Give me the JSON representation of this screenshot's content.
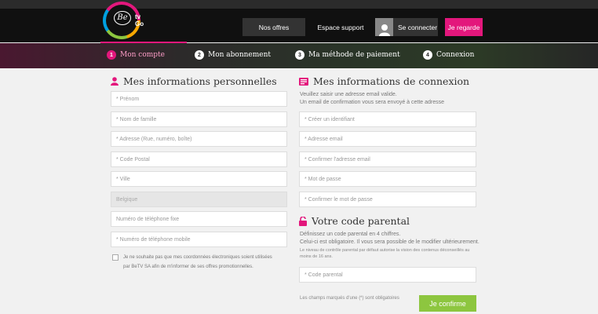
{
  "header": {
    "logo_text": "Be",
    "logo_sub1": "tv",
    "logo_sub2": "Go",
    "nav": {
      "offres": "Nos offres",
      "support": "Espace support",
      "connect": "Se connecter",
      "regarde": "Je regarde"
    }
  },
  "steps": [
    {
      "num": "1",
      "label": "Mon compte"
    },
    {
      "num": "2",
      "label": "Mon abonnement"
    },
    {
      "num": "3",
      "label": "Ma méthode de paiement"
    },
    {
      "num": "4",
      "label": "Connexion"
    }
  ],
  "personal": {
    "title": "Mes informations personnelles",
    "fields": [
      "* Prénom",
      "* Nom de famille",
      "* Adresse (Rue, numéro, boîte)",
      "* Code Postal",
      "* Ville",
      "Belgique",
      "Numéro de téléphone fixe",
      "* Numéro de téléphone mobile"
    ],
    "checkbox_text": "Je ne souhaite pas que mes coordonnées électroniques soient utilisées par BeTV SA afin de m'informer de ses offres promotionnelles."
  },
  "login": {
    "title": "Mes informations de connexion",
    "intro1": "Veuillez saisir une adresse email valide.",
    "intro2": "Un email de confirmation vous sera envoyé à cette adresse",
    "fields": [
      "* Créer un identifiant",
      "* Adresse email",
      "* Confirmer l'adresse email",
      "* Mot de passe",
      "* Confirmer le mot de passe"
    ]
  },
  "parental": {
    "title": "Votre code parental",
    "line1": "Définissez un code parental en 4 chiffres.",
    "line2": "Celui-ci est obligatoire. Il vous sera possible de le modifier ultérieurement.",
    "line3": "Le niveau de contrôle parental par défaut autorise la vision des contenus déconseillés au moins de 16 ans.",
    "field": "* Code parental"
  },
  "footer": {
    "note": "Les champs marqués d'une (*) sont obligatoires",
    "confirm": "Je confirme"
  },
  "colors": {
    "accent": "#e3177c",
    "confirm": "#8dc63f"
  }
}
